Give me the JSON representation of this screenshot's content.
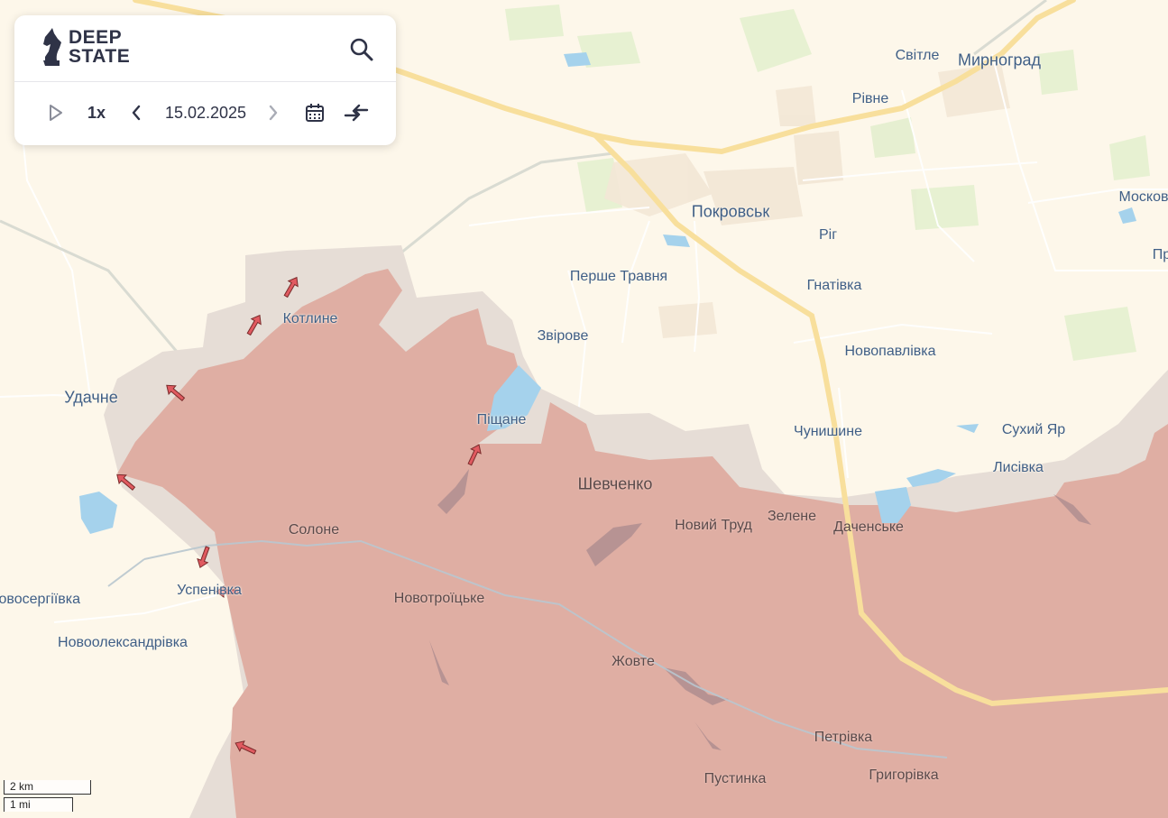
{
  "app": {
    "logo_line1": "DEEP",
    "logo_line2": "STATE"
  },
  "controls": {
    "speed": "1x",
    "date": "15.02.2025"
  },
  "scale": {
    "km": "2 km",
    "mi": "1 mi"
  },
  "places": {
    "mirnohrad": "Мирноград",
    "svitle": "Світле",
    "rivne": "Рівне",
    "pokrovsk": "Покровськ",
    "mosk": "Москов",
    "pr": "Пр",
    "rih": "Ріг",
    "pershe_travnia": "Перше Травня",
    "hnativka": "Гнатівка",
    "kotlyne": "Котлине",
    "zvirove": "Звірове",
    "novopavlivka": "Новопавлівка",
    "udachne": "Удачне",
    "pishchane": "Піщане",
    "chunyshyne": "Чунишине",
    "sukhyi_yar": "Сухий Яр",
    "lysivka": "Лисівка",
    "shevchenko": "Шевченко",
    "novyi_trud": "Новий Труд",
    "zelene": "Зелене",
    "dachenske": "Даченське",
    "solone": "Солоне",
    "uspenivka": "Успенівка",
    "novoserhiivka": "Новосергіївка",
    "novotroitske": "Новотроїцьке",
    "novooleksandrivka": "Новоолександрівка",
    "zhovte": "Жовте",
    "petrivka": "Петрівка",
    "pustynka": "Пустинка",
    "hryhorivka": "Григорівка"
  },
  "colors": {
    "background": "#fdf7ea",
    "occupied": "#dfaea3",
    "contested": "#e6ddd6",
    "water": "#a5d2ec",
    "highway": "#f8df9c",
    "arrow": "#e05a60",
    "label": "#3f5f86"
  }
}
